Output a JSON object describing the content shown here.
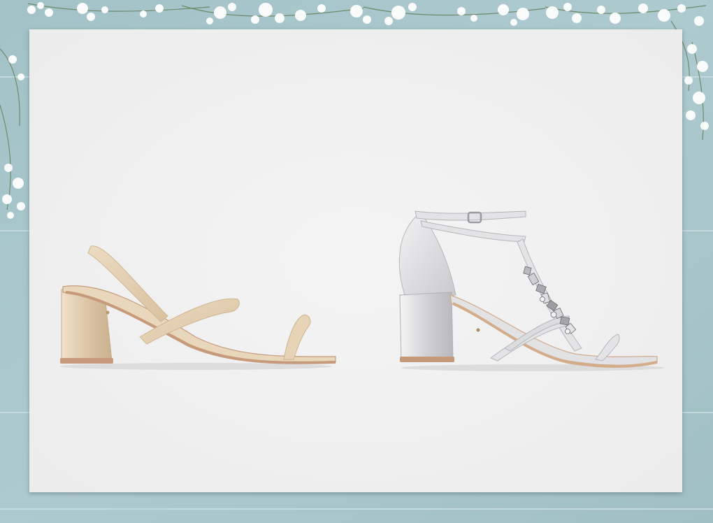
{
  "scene": {
    "background_color": "#a9c7cc",
    "plank_line_color": "#c2d8dc",
    "card_color": "#f2f2f2",
    "blossom_color": "#ffffff",
    "stem_color": "#6f8a6a"
  },
  "products": [
    {
      "kind": "sandal",
      "finish": "champagne-gold",
      "color": "#e3cfb3",
      "sole_color": "#c69a7b"
    },
    {
      "kind": "sandal",
      "finish": "silver-embellished",
      "color": "#d6d6d8",
      "sole_color": "#d3ac8a"
    }
  ]
}
